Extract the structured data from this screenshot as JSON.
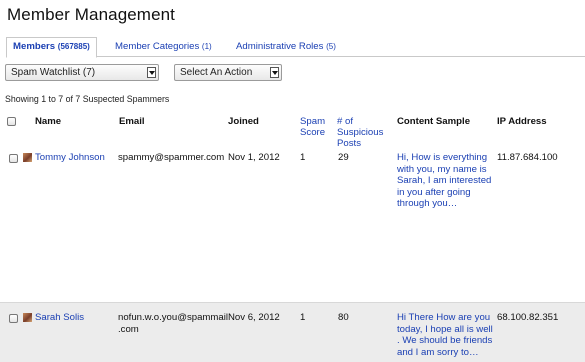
{
  "page": {
    "title": "Member Management"
  },
  "tabs": [
    {
      "label": "Members",
      "count": "(567885)",
      "active": true
    },
    {
      "label": "Member Categories",
      "count": "(1)",
      "active": false
    },
    {
      "label": "Administrative Roles",
      "count": "(5)",
      "active": false
    }
  ],
  "filters": {
    "watchlist_value": "Spam Watchlist (7)",
    "action_value": "Select An Action"
  },
  "summary": {
    "showing_text": "Showing 1 to 7 of 7 Suspected Spammers"
  },
  "table": {
    "headers": {
      "name": "Name",
      "email": "Email",
      "joined": "Joined",
      "spam_score_1": "Spam",
      "spam_score_2": "Score",
      "suspicious_1": "# of",
      "suspicious_2": "Suspicious",
      "suspicious_3": "Posts",
      "content_sample": "Content Sample",
      "ip_address": "IP Address"
    },
    "rows": [
      {
        "name": "Tommy Johnson",
        "email": "spammy@spammer.com",
        "joined": "Nov 1, 2012",
        "spam_score": "1",
        "suspicious_posts": "29",
        "content_lines": [
          "Hi, How is everything",
          "with you, my name is",
          "Sarah, I am interested",
          "in you after going",
          "through you…"
        ],
        "ip": "11.87.684.100"
      },
      {
        "name": "Sarah Solis",
        "email_lines": [
          "nofun.w.o.you@spammail",
          ".com"
        ],
        "joined": "Nov 6, 2012",
        "spam_score": "1",
        "suspicious_posts": "80",
        "content_lines": [
          "Hi There How are you",
          "today, I hope all is well",
          ". We should be friends",
          "and I am sorry to…"
        ],
        "ip": "68.100.82.351"
      }
    ]
  }
}
